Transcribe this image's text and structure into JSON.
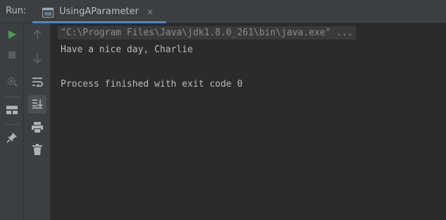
{
  "header": {
    "run_label": "Run:",
    "tab_label": "UsingAParameter",
    "close_glyph": "×",
    "accent_color": "#4a88c7"
  },
  "toolbar_left": {
    "icons": [
      "play-icon",
      "stop-icon",
      "settings-icon",
      "layout-icon",
      "pin-icon"
    ]
  },
  "toolbar_mid": {
    "icons": [
      "arrow-up-icon",
      "arrow-down-icon",
      "soft-wrap-icon",
      "scroll-to-end-icon",
      "print-icon",
      "trash-icon"
    ]
  },
  "console": {
    "command": "\"C:\\Program Files\\Java\\jdk1.8.0_261\\bin\\java.exe\" ...",
    "output_line": "Have a nice day, Charlie",
    "exit_line": "Process finished with exit code 0"
  },
  "colors": {
    "background": "#2b2b2b",
    "panel": "#3c3f41",
    "run_green": "#499c54",
    "text": "#bbbbbb"
  }
}
